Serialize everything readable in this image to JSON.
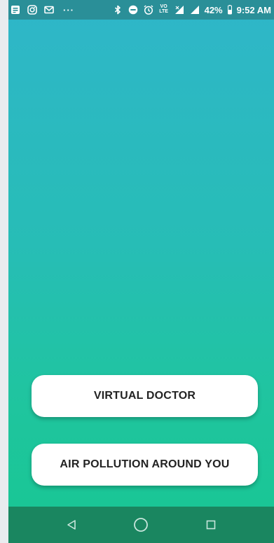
{
  "status_bar": {
    "icons_left": [
      "notes-icon",
      "instagram-icon",
      "gmail-icon"
    ],
    "more_indicator": "···",
    "icons_right": [
      "bluetooth-icon",
      "do-not-disturb-icon",
      "alarm-icon",
      "volte-icon",
      "signal-icon",
      "signal-4g-icon"
    ],
    "volte_label": "VO LTE",
    "network_label": "4G",
    "battery_percent": "42%",
    "time": "9:52 AM"
  },
  "buttons": {
    "virtual_doctor": "VIRTUAL DOCTOR",
    "air_pollution": "AIR POLLUTION AROUND YOU"
  },
  "nav_bar": {
    "icons": [
      "back-icon",
      "home-icon",
      "recents-icon"
    ]
  },
  "colors": {
    "gradient_top": "#2fb6c9",
    "gradient_bottom": "#18c693",
    "status_bar": "#2a8f98",
    "nav_bar": "#1a8660",
    "button_bg": "#ffffff",
    "button_text": "#222222"
  }
}
